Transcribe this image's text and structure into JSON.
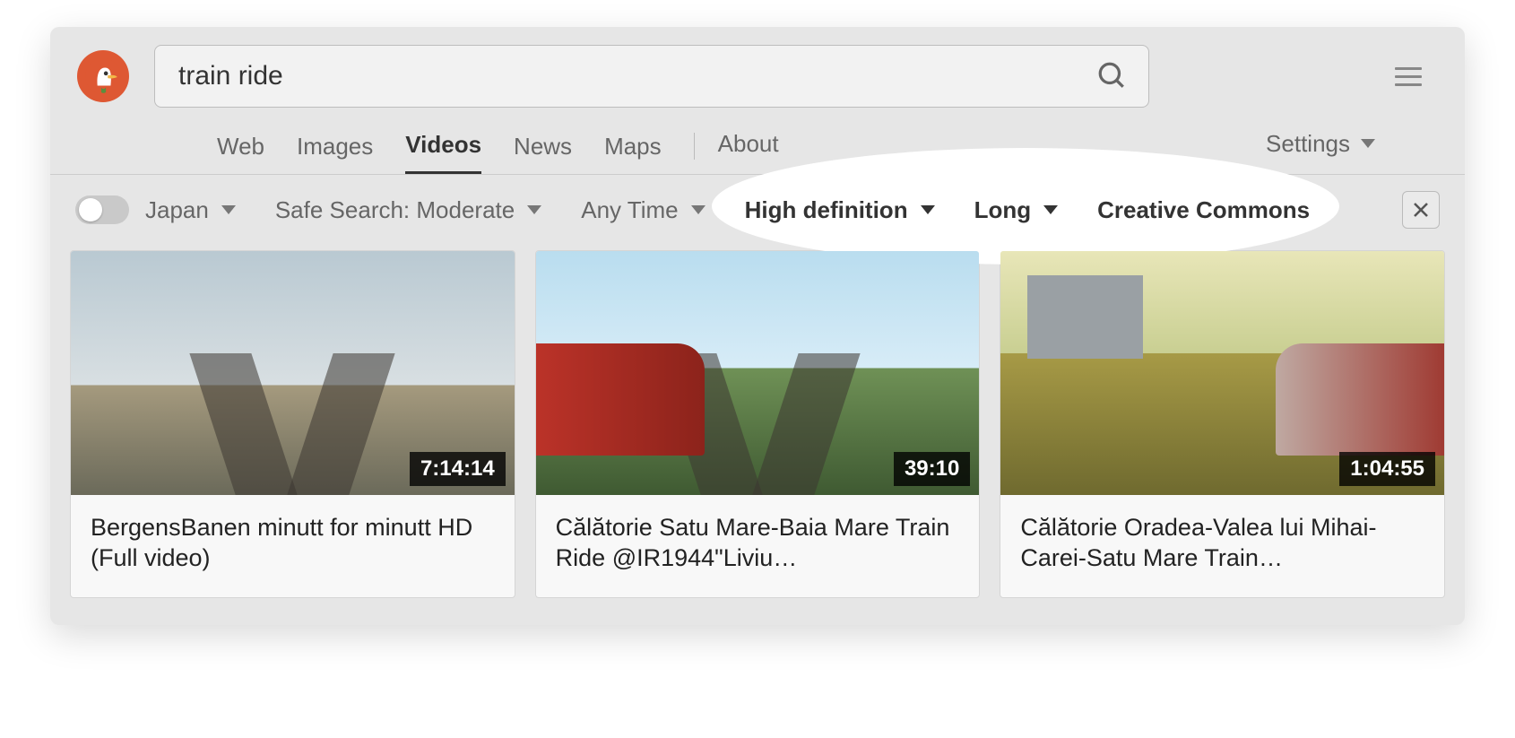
{
  "search": {
    "query": "train ride"
  },
  "tabs": {
    "web": "Web",
    "images": "Images",
    "videos": "Videos",
    "news": "News",
    "maps": "Maps",
    "about": "About",
    "active": "Videos"
  },
  "settings_label": "Settings",
  "filters": {
    "region": "Japan",
    "safesearch": "Safe Search: Moderate",
    "time": "Any Time",
    "resolution": "High definition",
    "duration": "Long",
    "license": "Creative Commons"
  },
  "results": [
    {
      "title": "BergensBanen minutt for minutt HD (Full video)",
      "duration": "7:14:14"
    },
    {
      "title": "Călătorie Satu Mare-Baia Mare Train Ride @IR1944\"Liviu…",
      "duration": "39:10"
    },
    {
      "title": "Călătorie Oradea-Valea lui Mihai-Carei-Satu Mare Train…",
      "duration": "1:04:55"
    }
  ]
}
